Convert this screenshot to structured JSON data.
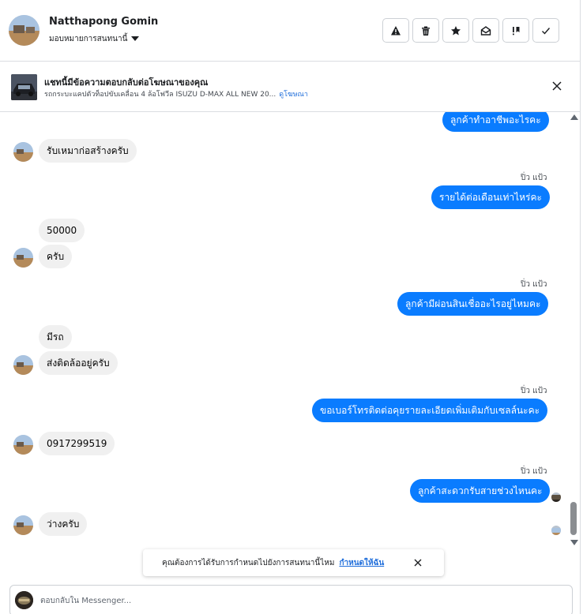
{
  "header": {
    "name": "Natthapong Gomin",
    "assign_label": "มอบหมายการสนทนานี้",
    "actions": [
      {
        "icon": "warning-icon",
        "name": "mark-spam-button"
      },
      {
        "icon": "trash-icon",
        "name": "delete-button"
      },
      {
        "icon": "star-icon",
        "name": "star-button"
      },
      {
        "icon": "envelope-open-icon",
        "name": "mark-unread-button"
      },
      {
        "icon": "exclamation-icon",
        "name": "follow-up-button"
      },
      {
        "icon": "check-icon",
        "name": "mark-done-button"
      }
    ]
  },
  "ad_banner": {
    "title": "แชทนี้มีข้อความตอบกลับต่อโฆษณาของคุณ",
    "subtitle": "รถกระบะแคปตัวท็อปขับเคลื่อน 4 ล้อโฟวีล ISUZU D-MAX ALL NEW 20...",
    "link": "ดูโฆษณา"
  },
  "messages": {
    "m0": "ลูกค้าทำอาชีพอะไรคะ",
    "m1": "รับเหมาก่อสร้างครับ",
    "s1": "ปิ่ว แป้ว",
    "m2": "รายได้ต่อเดือนเท่าไหร่คะ",
    "m3": "50000",
    "m4": "ครับ",
    "s2": "ปิ่ว แป้ว",
    "m5": "ลูกค้ามีผ่อนสินเชื่ออะไรอยู่ไหมคะ",
    "m6": "มีรถ",
    "m7": "ส่งติดล้ออยู่ครับ",
    "s3": "ปิ่ว แป้ว",
    "m8": "ขอเบอร์โทรติดต่อคุยรายละเอียดเพิ่มเติมกับเซลล์นะคะ",
    "m9": "0917299519",
    "s4": "ปิ่ว แป้ว",
    "m10": "ลูกค้าสะดวกรับสายช่วงไหนคะ",
    "m11": "ว่างครับ"
  },
  "toast": {
    "text": "คุณต้องการได้รับการกำหนดไปยังการสนทนานี้ไหม",
    "link": "กำหนดให้ฉัน"
  },
  "composer": {
    "placeholder": "ตอบกลับใน Messenger..."
  },
  "colors": {
    "outgoing_bubble": "#0a7cff",
    "incoming_bubble": "#f0f0f0",
    "link": "#216fdb"
  }
}
